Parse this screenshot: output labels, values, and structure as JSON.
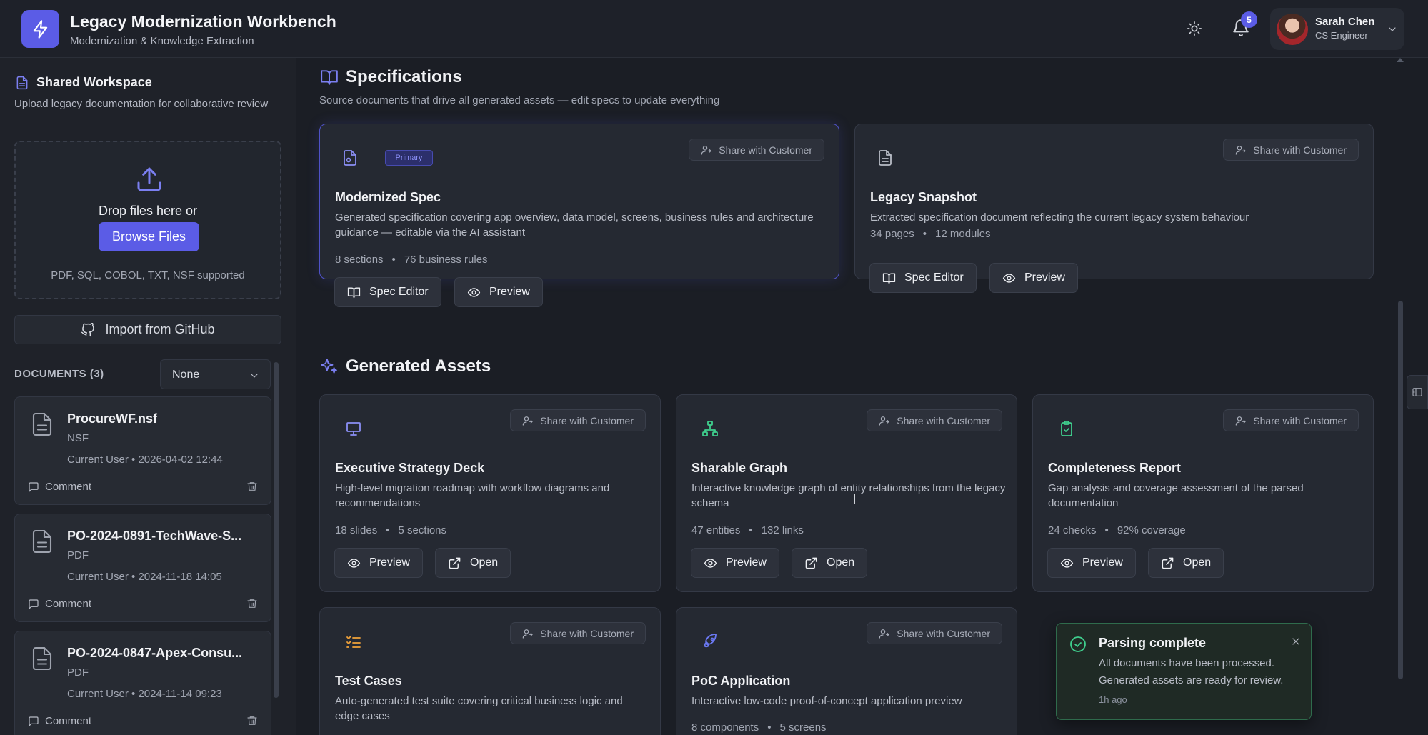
{
  "header": {
    "title": "Legacy Modernization Workbench",
    "subtitle": "Modernization & Knowledge Extraction",
    "notification_count": "5",
    "user_name": "Sarah Chen",
    "user_role": "CS Engineer"
  },
  "sidebar": {
    "workspace_title": "Shared Workspace",
    "workspace_desc": "Upload legacy documentation for collaborative review",
    "drop_text": "Drop files here or",
    "browse_label": "Browse Files",
    "formats": "PDF, SQL, COBOL, TXT, NSF supported",
    "github_label": "Import from GitHub",
    "documents_label": "DOCUMENTS (3)",
    "sort_value": "None",
    "documents": [
      {
        "name": "ProcureWF.nsf",
        "type": "NSF",
        "meta": "Current User • 2026-04-02 12:44",
        "comment": "Comment"
      },
      {
        "name": "PO-2024-0891-TechWave-S...",
        "type": "PDF",
        "meta": "Current User • 2024-11-18 14:05",
        "comment": "Comment"
      },
      {
        "name": "PO-2024-0847-Apex-Consu...",
        "type": "PDF",
        "meta": "Current User • 2024-11-14 09:23",
        "comment": "Comment"
      }
    ]
  },
  "specifications": {
    "title": "Specifications",
    "desc": "Source documents that drive all generated assets — edit specs to update everything",
    "cards": [
      {
        "tag": "Primary",
        "share": "Share with Customer",
        "title": "Modernized Spec",
        "desc": "Generated specification covering app overview, data model, screens, business rules and architecture guidance — editable via the AI assistant",
        "stat1": "8 sections",
        "stat2": "76 business rules",
        "btn1": "Spec Editor",
        "btn2": "Preview"
      },
      {
        "share": "Share with Customer",
        "title": "Legacy Snapshot",
        "desc": "Extracted specification document reflecting the current legacy system behaviour",
        "stat1": "34 pages",
        "stat2": "12 modules",
        "btn1": "Spec Editor",
        "btn2": "Preview"
      }
    ]
  },
  "assets": {
    "title": "Generated Assets",
    "cards": [
      {
        "share": "Share with Customer",
        "title": "Executive Strategy Deck",
        "desc": "High-level migration roadmap with workflow diagrams and recommendations",
        "stat1": "18 slides",
        "stat2": "5 sections",
        "btn1": "Preview",
        "btn2": "Open"
      },
      {
        "share": "Share with Customer",
        "title": "Sharable Graph",
        "desc": "Interactive knowledge graph of entity relationships from the legacy schema",
        "stat1": "47 entities",
        "stat2": "132 links",
        "btn1": "Preview",
        "btn2": "Open"
      },
      {
        "share": "Share with Customer",
        "title": "Completeness Report",
        "desc": "Gap analysis and coverage assessment of the parsed documentation",
        "stat1": "24 checks",
        "stat2": "92% coverage",
        "btn1": "Preview",
        "btn2": "Open"
      },
      {
        "share": "Share with Customer",
        "title": "Test Cases",
        "desc": "Auto-generated test suite covering critical business logic and edge cases"
      },
      {
        "share": "Share with Customer",
        "title": "PoC Application",
        "desc": "Interactive low-code proof-of-concept application preview",
        "stat1": "8 components",
        "stat2": "5 screens"
      }
    ]
  },
  "toast": {
    "title": "Parsing complete",
    "message": "All documents have been processed. Generated assets are ready for review.",
    "time": "1h ago"
  },
  "colors": {
    "accent": "#5b5ce6",
    "background": "#1b1e25",
    "card": "#252932",
    "success": "#3fcf8e"
  },
  "icons": [
    "bolt-icon",
    "sun-icon",
    "bell-icon",
    "chevron-down-icon",
    "file-icon",
    "upload-icon",
    "github-icon",
    "comment-icon",
    "trash-icon",
    "book-icon",
    "eye-icon",
    "share-user-icon",
    "sparkles-icon",
    "presentation-icon",
    "network-icon",
    "clipboard-check-icon",
    "checklist-icon",
    "rocket-icon",
    "external-link-icon",
    "check-circle-icon",
    "close-icon",
    "panel-icon"
  ]
}
